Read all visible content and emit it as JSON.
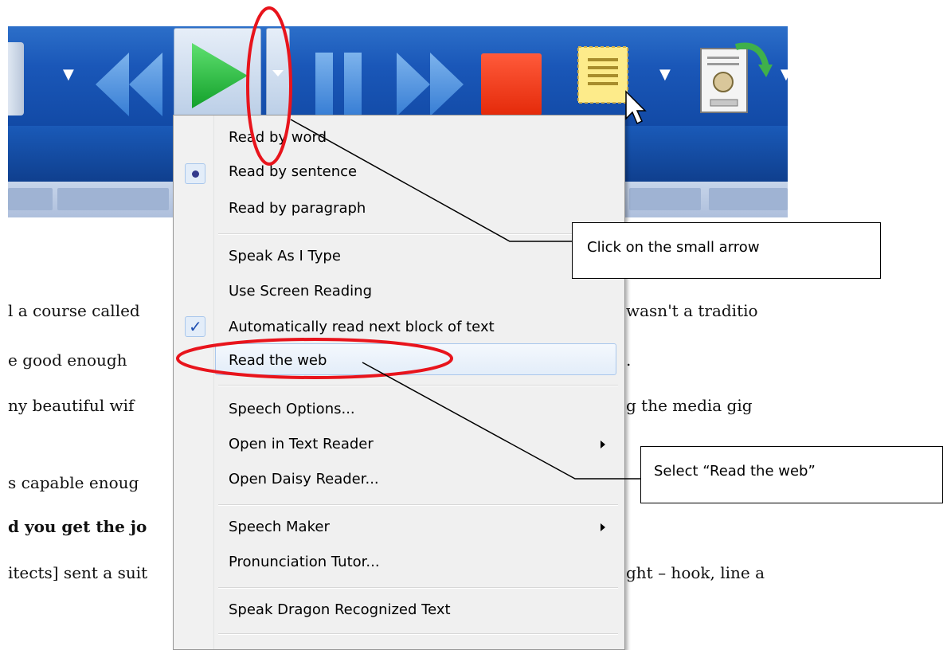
{
  "menu": {
    "items": [
      {
        "label": "Read by word"
      },
      {
        "label": "Read by sentence",
        "state": "radio-selected"
      },
      {
        "label": "Read by paragraph"
      },
      {
        "label": "Speak As I Type"
      },
      {
        "label": "Use Screen Reading"
      },
      {
        "label": "Automatically read next block of text",
        "state": "checked"
      },
      {
        "label": "Read the web",
        "state": "hover"
      },
      {
        "label": "Speech Options..."
      },
      {
        "label": "Open in Text Reader",
        "submenu": true
      },
      {
        "label": "Open Daisy Reader..."
      },
      {
        "label": "Speech Maker",
        "submenu": true
      },
      {
        "label": "Pronunciation Tutor..."
      },
      {
        "label": "Speak Dragon Recognized Text"
      }
    ]
  },
  "document": {
    "lines": [
      "l a course called",
      "e good enough",
      "ny beautiful wif",
      "s capable enoug",
      "d you get the jo",
      "itects] sent a suit"
    ],
    "right_lines": [
      "wasn't a traditio",
      ".",
      "g the media gig",
      "ght – hook, line a"
    ]
  },
  "callouts": {
    "arrow_note": "Click on the small arrow",
    "web_note": "Select “Read the web”"
  },
  "icons": {
    "radio": "●",
    "check": "✓"
  },
  "colors": {
    "toolbar_blue": "#1a57b8",
    "play_green": "#22b53a",
    "stop_red": "#e42a0a",
    "annotation_red": "#e8141c",
    "menu_bg": "#f0f0f0"
  }
}
